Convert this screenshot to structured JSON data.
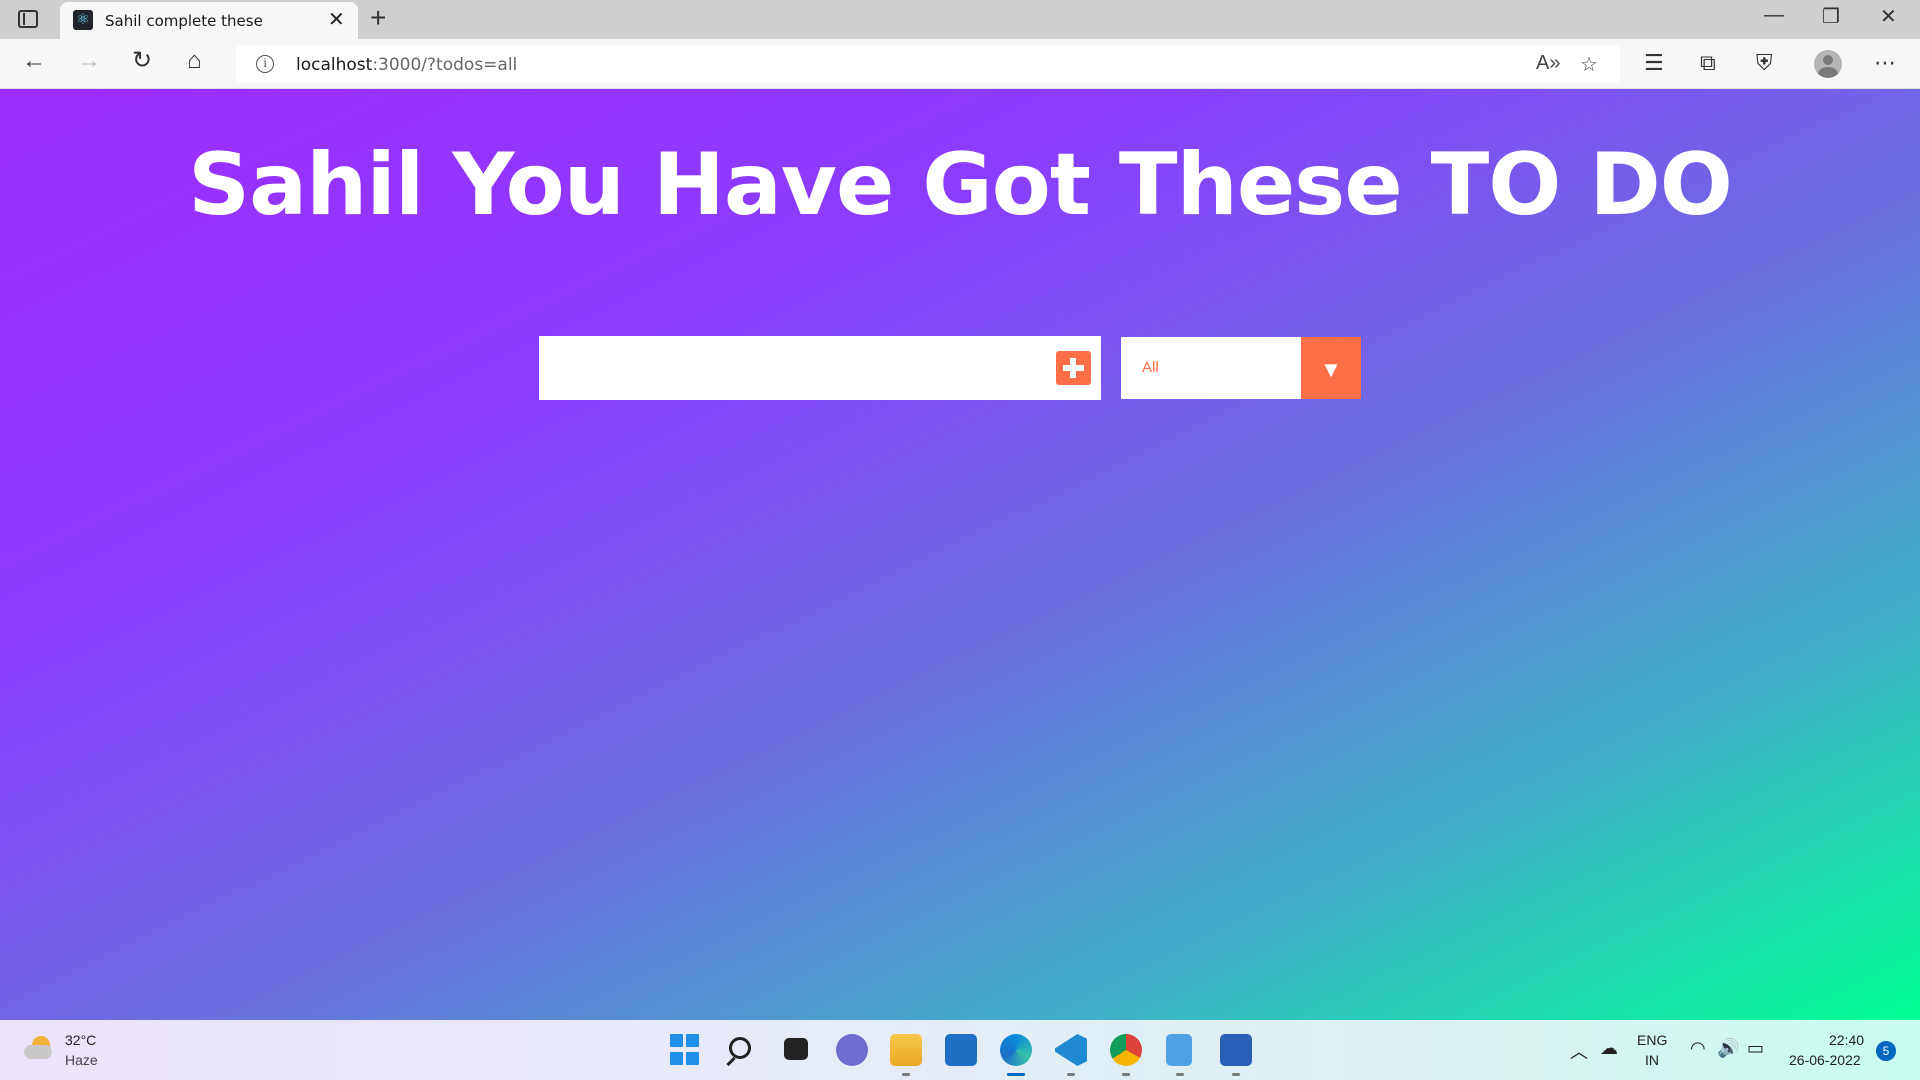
{
  "browser": {
    "tab": {
      "title": "Sahil complete these"
    },
    "new_tab_label": "+",
    "window_controls": {
      "minimize": "—",
      "restore": "❐",
      "close": "✕"
    },
    "address": {
      "host": "localhost",
      "rest": ":3000/?todos=all"
    },
    "icons": {
      "back": "back-arrow-icon",
      "forward": "forward-arrow-icon",
      "refresh": "refresh-icon",
      "home": "home-icon",
      "read_aloud": "read-aloud-icon",
      "add_favorite": "add-favorite-icon",
      "favorites": "favorites-icon",
      "collections": "collections-icon",
      "browser_essentials": "shield-icon",
      "profile": "profile-icon",
      "more": "more-icon"
    }
  },
  "page": {
    "headline": "Sahil You Have Got These TO DO",
    "todo_input": {
      "value": "",
      "placeholder": ""
    },
    "filter": {
      "selected": "All"
    },
    "colors": {
      "gradient_start": "#9d2cff",
      "gradient_end": "#00ff95",
      "accent": "#ff6f47"
    }
  },
  "taskbar": {
    "weather": {
      "temp": "32°C",
      "condition": "Haze"
    },
    "apps": [
      "start-icon",
      "search-icon",
      "task-view-icon",
      "chat-icon",
      "file-explorer-icon",
      "store-icon",
      "edge-icon",
      "vscode-icon",
      "chrome-icon",
      "notepad-icon",
      "word-icon"
    ],
    "language": {
      "line1": "ENG",
      "line2": "IN"
    },
    "clock": {
      "time": "22:40",
      "date": "26-06-2022"
    },
    "notifications": "5"
  }
}
